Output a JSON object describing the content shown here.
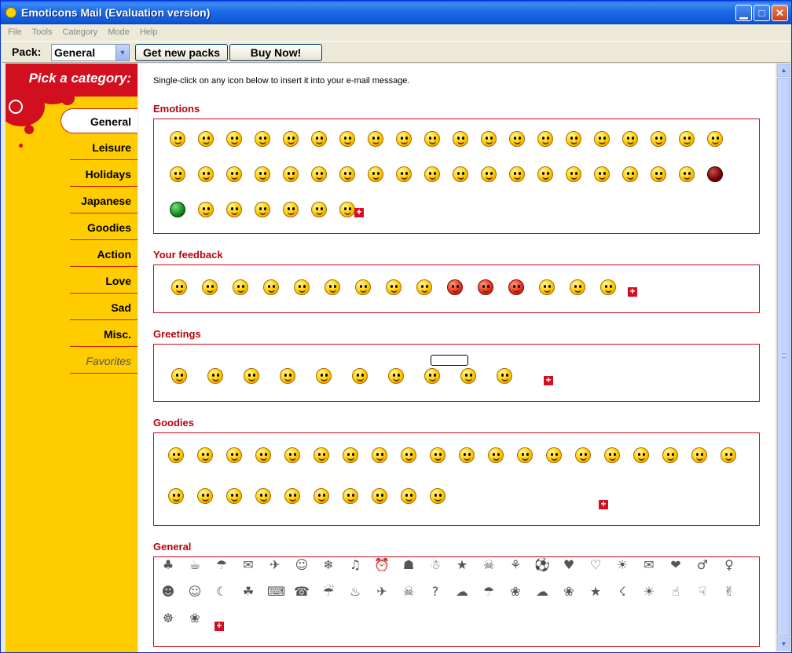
{
  "window": {
    "title": "Emoticons Mail  (Evaluation version)",
    "minimize_glyph": "▁",
    "maximize_glyph": "□",
    "close_glyph": "✕"
  },
  "menu": [
    "File",
    "Tools",
    "Category",
    "Mode",
    "Help"
  ],
  "toolbar": {
    "pack_label": "Pack:",
    "pack_value": "General",
    "get_packs_label": "Get new packs",
    "buy_label": "Buy Now!"
  },
  "sidebar": {
    "title": "Pick a category:",
    "categories": [
      "General",
      "Leisure",
      "Holidays",
      "Japanese",
      "Goodies",
      "Action",
      "Love",
      "Sad",
      "Misc.",
      "Favorites"
    ],
    "active": "General"
  },
  "main": {
    "instruction": "Single-click on any icon below to insert it into your e-mail message.",
    "sections": [
      {
        "title": "Emotions",
        "icon_count": 48
      },
      {
        "title": "Your feedback",
        "icon_count": 15
      },
      {
        "title": "Greetings",
        "icon_count": 10
      },
      {
        "title": "Goodies",
        "icon_count": 30
      },
      {
        "title": "General",
        "icon_count": 52
      }
    ],
    "more_glyph": "+"
  },
  "general_icons": [
    "♣",
    "☕",
    "☂",
    "✉",
    "✈",
    "☺",
    "❄",
    "♫",
    "⏰",
    "☗",
    "☃",
    "★",
    "☠",
    "⚘",
    "⚽",
    "♥",
    "♡",
    "☀",
    "✉",
    "❤",
    "♂",
    "♀",
    "☻",
    "☺",
    "☾",
    "☘",
    "⌨",
    "☎",
    "☔",
    "♨",
    "✈",
    "☠",
    "?",
    "☁",
    "☂",
    "❀",
    "☁",
    "❀",
    "★",
    "☇",
    "☀",
    "☝",
    "☟",
    "✌",
    "☸",
    "❀",
    "☃",
    "☂"
  ],
  "colors": {
    "accent_red": "#c80a14",
    "sidebar_yellow": "#ffcc00",
    "title_blue": "#0a5fd8"
  }
}
